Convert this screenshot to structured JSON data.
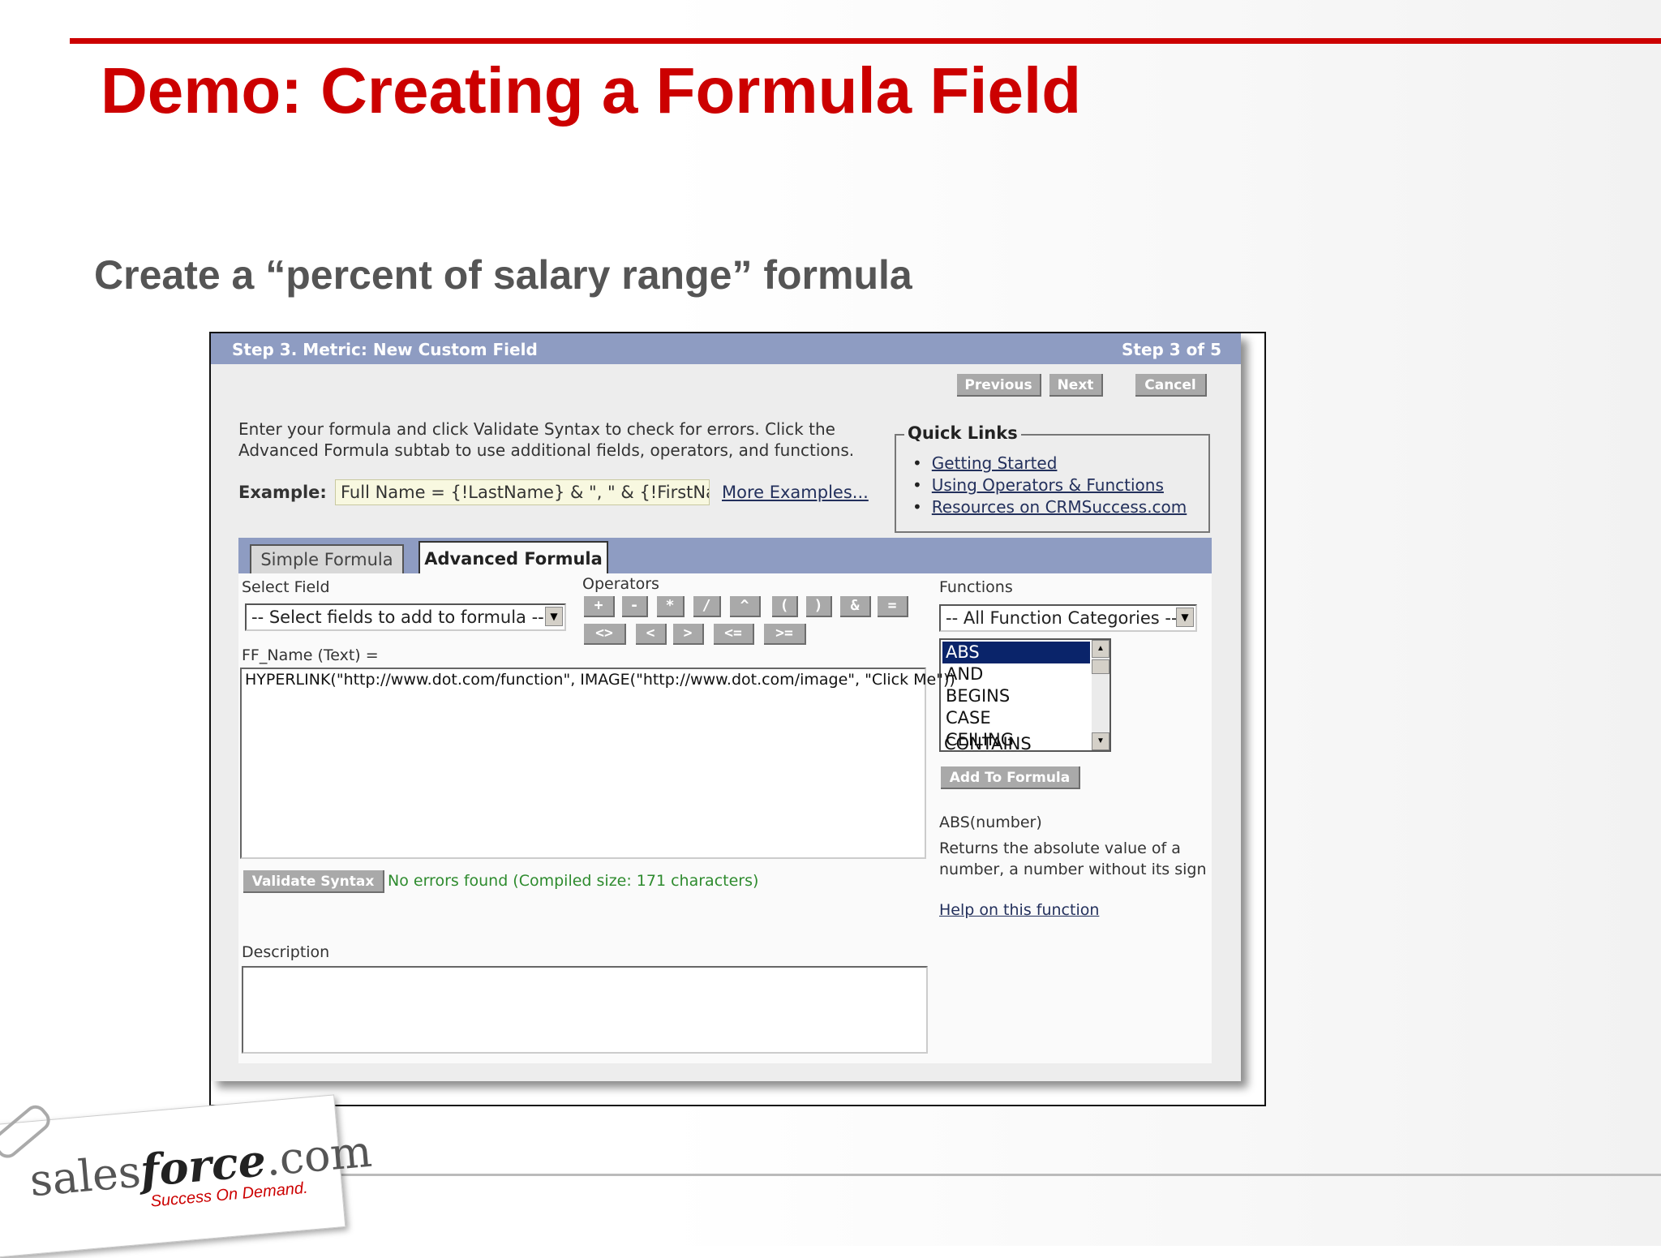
{
  "slide": {
    "title": "Demo: Creating a Formula Field",
    "subtitle": "Create a “percent of salary range” formula"
  },
  "wizard": {
    "header_title": "Step 3. Metric: New Custom Field",
    "step_indicator": "Step 3 of 5",
    "buttons": {
      "previous": "Previous",
      "next": "Next",
      "cancel": "Cancel"
    },
    "intro_line1": "Enter your formula and click Validate Syntax to check for errors. Click the",
    "intro_line2": "Advanced Formula subtab to use additional fields, operators, and functions.",
    "example_label": "Example:",
    "example_value": "Full Name = {!LastName} & \", \" & {!FirstName}",
    "more_examples": "More Examples...",
    "quick_links": {
      "title": "Quick Links",
      "items": [
        "Getting Started",
        "Using Operators & Functions",
        "Resources on CRMSuccess.com"
      ]
    },
    "tabs": {
      "simple": "Simple Formula",
      "advanced": "Advanced Formula"
    },
    "select_field_label": "Select Field",
    "select_field_value": "-- Select fields to add to formula --",
    "operators_label": "Operators",
    "operators_row1": [
      "+",
      "-",
      "*",
      "/",
      "^",
      "(",
      ")",
      "&",
      "="
    ],
    "operators_row2": [
      "<>",
      "<",
      ">",
      "<=",
      ">="
    ],
    "functions_label": "Functions",
    "function_category": "-- All Function Categories --",
    "function_list": [
      "ABS",
      "AND",
      "BEGINS",
      "CASE",
      "CEILING",
      "CONTAINS"
    ],
    "selected_function": "ABS",
    "add_to_formula": "Add To Formula",
    "function_signature": "ABS(number)",
    "function_desc_line1": "Returns the absolute value of a",
    "function_desc_line2": "number, a number without its sign",
    "help_link": "Help on this function",
    "formula_label": "FF_Name (Text) =",
    "formula_value": "HYPERLINK(\"http://www.dot.com/function\",  IMAGE(\"http://www.dot.com/image\", \"Click Me\"))",
    "validate_button": "Validate Syntax",
    "validate_result": "No errors found (Compiled size: 171 characters)",
    "description_label": "Description",
    "description_value": ""
  },
  "logo": {
    "brand_left": "sales",
    "brand_right": "force",
    "brand_suffix": ".com",
    "tagline": "Success On Demand."
  },
  "colors": {
    "accent_red": "#cc0000",
    "header_blue": "#8e9cc2",
    "button_gray": "#a9a9a9",
    "success_green": "#2e8b2e"
  }
}
